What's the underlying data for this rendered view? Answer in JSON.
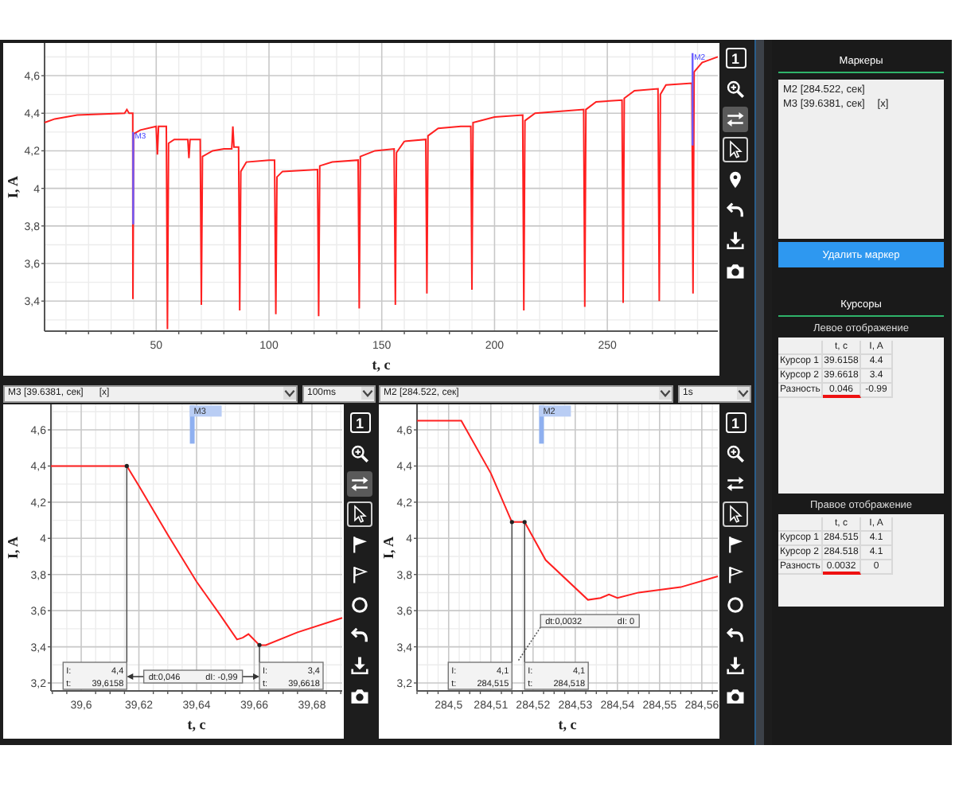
{
  "overview": {
    "chart_data": {
      "type": "line",
      "xlabel": "t, c",
      "ylabel": "I, A",
      "grid": true,
      "xlim": [
        0.5,
        299
      ],
      "ylim": [
        3.24,
        4.774
      ],
      "xticks": [
        50,
        100,
        150,
        200,
        250
      ],
      "yticks": [
        {
          "value": 3.4,
          "label": "3,4"
        },
        {
          "value": 3.6,
          "label": "3,6"
        },
        {
          "value": 3.8,
          "label": "3,8"
        },
        {
          "value": 4,
          "label": "4"
        },
        {
          "value": 4.2,
          "label": "4,2"
        },
        {
          "value": 4.4,
          "label": "4,4"
        },
        {
          "value": 4.6,
          "label": "4,6"
        }
      ],
      "x": [
        0.5,
        5,
        15,
        36,
        37,
        38,
        39.6,
        39.7,
        40,
        43,
        50,
        50.5,
        51,
        54.5,
        55,
        55.5,
        58,
        64,
        64.5,
        65,
        69.5,
        70,
        70.5,
        75,
        80,
        83.5,
        84,
        84.5,
        86.5,
        87,
        87.5,
        90,
        100,
        102.5,
        103,
        103.5,
        106,
        121.5,
        122,
        122.5,
        128,
        139.5,
        140,
        140.5,
        147,
        155.5,
        156,
        156.5,
        160,
        169.5,
        170,
        170.5,
        175,
        185,
        189.5,
        190,
        190.5,
        200,
        212.5,
        213,
        213.5,
        218,
        239.5,
        240,
        240.5,
        245,
        256.5,
        257,
        257.5,
        262,
        272.5,
        273,
        273.5,
        276,
        287.5,
        288,
        288.5,
        292,
        299
      ],
      "series": [
        {
          "color": "#ff2020",
          "values": [
            4.35,
            4.37,
            4.39,
            4.4,
            4.42,
            4.4,
            4.4,
            3.41,
            4.29,
            4.31,
            4.33,
            4.18,
            4.33,
            4.33,
            3.25,
            4.24,
            4.26,
            4.26,
            4.16,
            4.26,
            4.26,
            3.38,
            4.17,
            4.2,
            4.21,
            4.21,
            4.33,
            4.22,
            4.22,
            3.35,
            4.09,
            4.14,
            4.15,
            4.15,
            3.33,
            4.06,
            4.09,
            4.1,
            3.32,
            4.12,
            4.14,
            4.15,
            3.36,
            4.17,
            4.2,
            4.21,
            3.38,
            4.19,
            4.25,
            4.26,
            3.44,
            4.28,
            4.32,
            4.33,
            4.33,
            3.46,
            4.35,
            4.38,
            4.39,
            3.35,
            4.36,
            4.4,
            4.42,
            3.37,
            4.42,
            4.46,
            4.47,
            3.39,
            4.48,
            4.52,
            4.53,
            3.4,
            4.5,
            4.55,
            4.56,
            3.44,
            4.62,
            4.67,
            4.7
          ]
        }
      ],
      "annotations": [
        "M3",
        "M2"
      ]
    },
    "toolbar": [
      {
        "kind": "page",
        "label": "1",
        "on": false,
        "selected": false
      },
      {
        "kind": "zoom",
        "on": false,
        "selected": false
      },
      {
        "kind": "swap",
        "on": true,
        "selected": false
      },
      {
        "kind": "pointer",
        "on": false,
        "selected": true
      },
      {
        "kind": "pin",
        "on": false,
        "selected": false
      },
      {
        "kind": "undo",
        "on": false,
        "selected": false
      },
      {
        "kind": "download",
        "on": false,
        "selected": false
      },
      {
        "kind": "camera",
        "on": false,
        "selected": false
      }
    ]
  },
  "panes": [
    {
      "marker_select": "M3 [39.6381, сек]",
      "marker_remove": "[x]",
      "scale_select": "100ms",
      "chart_data": {
        "type": "line",
        "xlabel": "t, c",
        "ylabel": "I, A",
        "grid": true,
        "xlim": [
          39.5895,
          39.6905
        ],
        "ylim": [
          3.156,
          4.741
        ],
        "xticks": [
          {
            "value": 39.6,
            "label": "39,6"
          },
          {
            "value": 39.62,
            "label": "39,62"
          },
          {
            "value": 39.64,
            "label": "39,64"
          },
          {
            "value": 39.66,
            "label": "39,66"
          },
          {
            "value": 39.68,
            "label": "39,68"
          }
        ],
        "yticks": [
          {
            "value": 3.2,
            "label": "3,2"
          },
          {
            "value": 3.4,
            "label": "3,4"
          },
          {
            "value": 3.6,
            "label": "3,6"
          },
          {
            "value": 3.8,
            "label": "3,8"
          },
          {
            "value": 4,
            "label": "4"
          },
          {
            "value": 4.2,
            "label": "4,2"
          },
          {
            "value": 4.4,
            "label": "4,4"
          },
          {
            "value": 4.6,
            "label": "4,6"
          }
        ],
        "x": [
          39.5895,
          39.6158,
          39.62,
          39.63,
          39.64,
          39.648,
          39.654,
          39.656,
          39.658,
          39.6618,
          39.664,
          39.675,
          39.6905
        ],
        "series": [
          {
            "color": "#ff2020",
            "values": [
              4.4,
              4.4,
              4.29,
              4.02,
              3.76,
              3.58,
              3.44,
              3.45,
              3.47,
              3.41,
              3.41,
              3.48,
              3.56
            ]
          }
        ],
        "annotations": [
          "M3",
          "39,6158",
          "39,6618"
        ]
      },
      "cursor_readouts": [
        {
          "i_label": "I:",
          "i": "4,4",
          "t_label": "t:"
        },
        {
          "i_label": "I:",
          "i": "3,4",
          "t_label": "t:"
        }
      ],
      "delta": {
        "kind": "arrows",
        "dt": "dt:0,046",
        "di": "dI:  -0,99"
      },
      "toolbar": [
        {
          "kind": "page",
          "label": "1",
          "on": false,
          "selected": false
        },
        {
          "kind": "zoom",
          "on": false,
          "selected": false
        },
        {
          "kind": "swap",
          "on": true,
          "selected": false
        },
        {
          "kind": "pointer",
          "on": false,
          "selected": true
        },
        {
          "kind": "flag",
          "on": false,
          "selected": false
        },
        {
          "kind": "flag_outline",
          "on": false,
          "selected": false
        },
        {
          "kind": "circle",
          "on": false,
          "selected": false
        },
        {
          "kind": "undo",
          "on": false,
          "selected": false
        },
        {
          "kind": "download",
          "on": false,
          "selected": false
        },
        {
          "kind": "camera",
          "on": false,
          "selected": false
        }
      ]
    },
    {
      "marker_select": "M2 [284.522, сек]",
      "scale_select": "1s",
      "chart_data": {
        "type": "line",
        "xlabel": "t, c",
        "ylabel": "I, A",
        "grid": true,
        "xlim": [
          284.4925,
          284.5638
        ],
        "ylim": [
          3.156,
          4.741
        ],
        "xticks": [
          {
            "value": 284.5,
            "label": "284,5"
          },
          {
            "value": 284.51,
            "label": "284,51"
          },
          {
            "value": 284.52,
            "label": "284,52"
          },
          {
            "value": 284.53,
            "label": "284,53"
          },
          {
            "value": 284.54,
            "label": "284,54"
          },
          {
            "value": 284.55,
            "label": "284,55"
          },
          {
            "value": 284.56,
            "label": "284,56"
          }
        ],
        "yticks": [
          {
            "value": 3.2,
            "label": "3,2"
          },
          {
            "value": 3.4,
            "label": "3,4"
          },
          {
            "value": 3.6,
            "label": "3,6"
          },
          {
            "value": 3.8,
            "label": "3,8"
          },
          {
            "value": 4,
            "label": "4"
          },
          {
            "value": 4.2,
            "label": "4,2"
          },
          {
            "value": 4.4,
            "label": "4,4"
          },
          {
            "value": 4.6,
            "label": "4,6"
          }
        ],
        "x": [
          284.4925,
          284.503,
          284.51,
          284.515,
          284.518,
          284.523,
          284.533,
          284.536,
          284.538,
          284.54,
          284.545,
          284.555,
          284.5638
        ],
        "series": [
          {
            "color": "#ff2020",
            "values": [
              4.65,
              4.65,
              4.36,
              4.09,
              4.09,
              3.88,
              3.66,
              3.67,
              3.69,
              3.67,
              3.7,
              3.73,
              3.79
            ]
          }
        ],
        "annotations": [
          "M2",
          "284,515",
          "284,518"
        ]
      },
      "cursor_readouts": [
        {
          "i_label": "I:",
          "i": "4,1",
          "t_label": "t:"
        },
        {
          "i_label": "I:",
          "i": "4,1",
          "t_label": "t:"
        }
      ],
      "delta": {
        "kind": "leader",
        "dt": "dt:0,0032",
        "di": "dI:  0"
      },
      "toolbar": [
        {
          "kind": "page",
          "label": "1",
          "on": false,
          "selected": false
        },
        {
          "kind": "zoom",
          "on": false,
          "selected": false
        },
        {
          "kind": "swap",
          "on": false,
          "selected": false
        },
        {
          "kind": "pointer",
          "on": false,
          "selected": true
        },
        {
          "kind": "flag",
          "on": false,
          "selected": false
        },
        {
          "kind": "flag_outline",
          "on": false,
          "selected": false
        },
        {
          "kind": "circle",
          "on": false,
          "selected": false
        },
        {
          "kind": "undo",
          "on": false,
          "selected": false
        },
        {
          "kind": "download",
          "on": false,
          "selected": false
        },
        {
          "kind": "camera",
          "on": false,
          "selected": false
        }
      ]
    }
  ],
  "side_panel": {
    "markers_title": "Маркеры",
    "markers": [
      {
        "text": "M2 [284.522, сек]"
      },
      {
        "text": "M3 [39.6381, сек]",
        "remove": "[x]"
      }
    ],
    "delete_button": "Удалить маркер",
    "cursors_title": "Курсоры",
    "tables": [
      {
        "title": "Левое отображение",
        "columns": [
          "t, c",
          "I, A"
        ],
        "rows": [
          {
            "label": "Курсор 1",
            "t": "39.6158",
            "i": "4.4",
            "highlight": false
          },
          {
            "label": "Курсор 2",
            "t": "39.6618",
            "i": "3.4",
            "highlight": false
          },
          {
            "label": "Разность",
            "t": "0.046",
            "i": "-0.99",
            "highlight": true
          }
        ]
      },
      {
        "title": "Правое отображение",
        "columns": [
          "t, c",
          "I, A"
        ],
        "rows": [
          {
            "label": "Курсор 1",
            "t": "284.515",
            "i": "4.1",
            "highlight": false
          },
          {
            "label": "Курсор 2",
            "t": "284.518",
            "i": "4.1",
            "highlight": false
          },
          {
            "label": "Разность",
            "t": "0.0032",
            "i": "0",
            "highlight": true
          }
        ]
      }
    ]
  }
}
